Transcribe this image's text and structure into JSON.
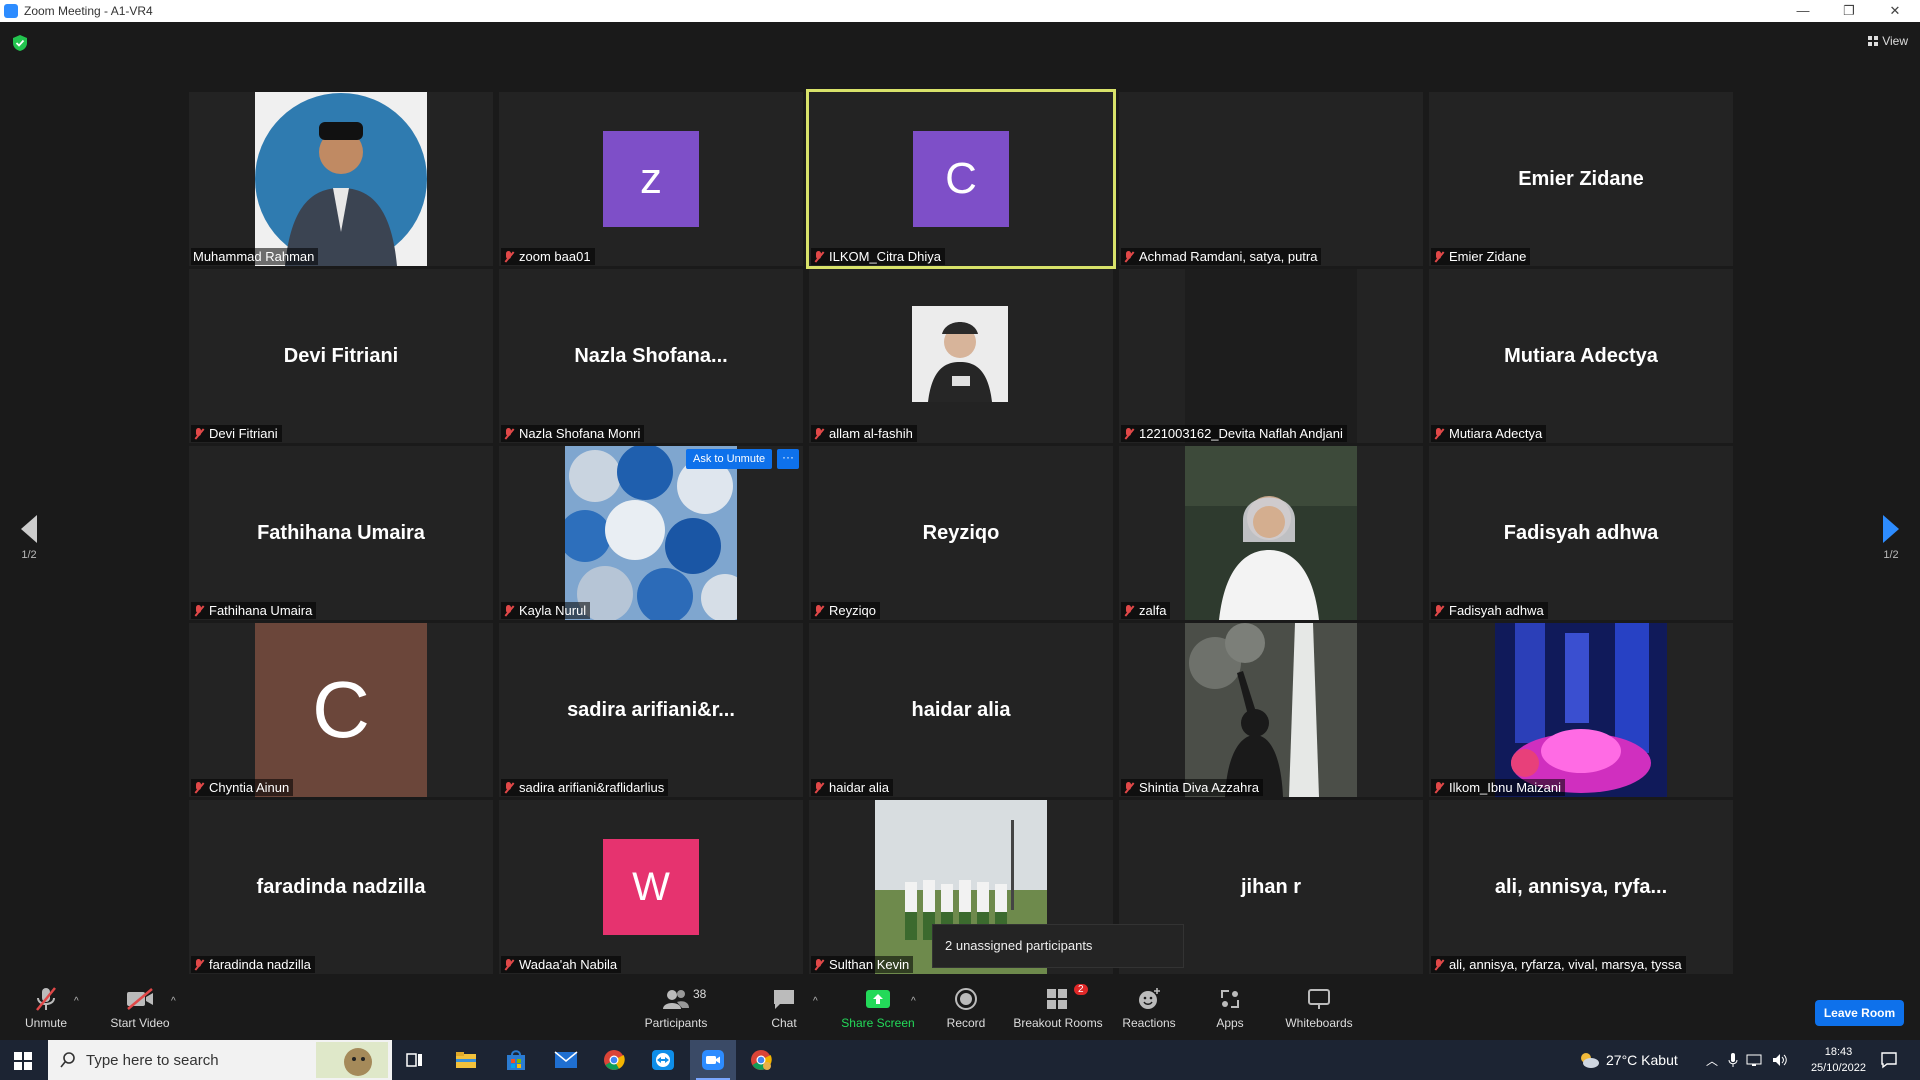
{
  "window": {
    "title": "Zoom Meeting - A1-VR4",
    "minimize": "—",
    "restore": "❐",
    "close": "✕"
  },
  "top": {
    "view_label": "View"
  },
  "tiles": [
    {
      "label": "Muhammad Rahman",
      "display": "photo",
      "muted": false
    },
    {
      "label": "zoom baa01",
      "display": "avatar",
      "initial": "z",
      "avatar_color": "#7e4fc8",
      "muted": true
    },
    {
      "label": "ILKOM_Citra Dhiya",
      "display": "avatar",
      "initial": "C",
      "avatar_color": "#7e4fc8",
      "muted": true,
      "active": true
    },
    {
      "label": "Achmad Ramdani, satya, putra",
      "display": "blank",
      "muted": true
    },
    {
      "label": "Emier Zidane",
      "display": "name",
      "big": "Emier Zidane",
      "muted": true
    },
    {
      "label": "Devi Fitriani",
      "display": "name",
      "big": "Devi Fitriani",
      "muted": true
    },
    {
      "label": "Nazla Shofana Monri",
      "display": "name",
      "big": "Nazla  Shofana...",
      "muted": true
    },
    {
      "label": "allam al-fashih",
      "display": "photo-small",
      "muted": true
    },
    {
      "label": "1221003162_Devita Naflah Andjani",
      "display": "blank",
      "muted": true
    },
    {
      "label": "Mutiara Adectya",
      "display": "name",
      "big": "Mutiara Adectya",
      "muted": true
    },
    {
      "label": "Fathihana Umaira",
      "display": "name",
      "big": "Fathihana Umaira",
      "muted": true
    },
    {
      "label": "Kayla Nurul",
      "display": "photo",
      "muted": true
    },
    {
      "label": "Reyziqo",
      "display": "name",
      "big": "Reyziqo",
      "muted": true
    },
    {
      "label": "zalfa",
      "display": "photo",
      "muted": true
    },
    {
      "label": "Fadisyah adhwa",
      "display": "name",
      "big": "Fadisyah adhwa",
      "muted": true
    },
    {
      "label": "Chyntia Ainun",
      "display": "avatar-large",
      "initial": "C",
      "avatar_color": "#6b463a",
      "muted": true
    },
    {
      "label": "sadira arifiani&raflidarlius",
      "display": "name",
      "big": "sadira  arifiani&r...",
      "muted": true
    },
    {
      "label": "haidar alia",
      "display": "name",
      "big": "haidar alia",
      "muted": true
    },
    {
      "label": "Shintia Diva Azzahra",
      "display": "photo",
      "muted": true
    },
    {
      "label": "Ilkom_Ibnu Maizani",
      "display": "photo",
      "muted": true
    },
    {
      "label": "faradinda nadzilla",
      "display": "name",
      "big": "faradinda nadzilla",
      "muted": true
    },
    {
      "label": "Wadaa'ah Nabila",
      "display": "avatar",
      "initial": "W",
      "avatar_color": "#e6336f",
      "muted": true
    },
    {
      "label": "Sulthan Kevin",
      "display": "photo",
      "muted": true
    },
    {
      "label": "",
      "display": "name",
      "big": "jihan r",
      "muted": false
    },
    {
      "label": "ali, annisya, ryfarza, vival, marsya, tyssa",
      "display": "name",
      "big": "ali,  annisya,  ryfa...",
      "muted": true
    }
  ],
  "overlay": {
    "ask_unmute": "Ask to Unmute",
    "more": "···",
    "tooltip": "2 unassigned participants"
  },
  "pager": {
    "left": "1/2",
    "right": "1/2"
  },
  "toolbar": {
    "unmute": "Unmute",
    "start_video": "Start Video",
    "participants": "Participants",
    "participants_count": "38",
    "chat": "Chat",
    "share_screen": "Share Screen",
    "record": "Record",
    "breakout_rooms": "Breakout Rooms",
    "breakout_badge": "2",
    "reactions": "Reactions",
    "apps": "Apps",
    "whiteboards": "Whiteboards",
    "leave": "Leave Room"
  },
  "taskbar": {
    "search_placeholder": "Type here to search",
    "weather": "27°C  Kabut",
    "time": "18:43",
    "date": "25/10/2022"
  },
  "colors": {
    "accent": "#0e71eb",
    "active_border": "#d8e26a",
    "share_green": "#23d959",
    "muted_red": "#e04848"
  }
}
